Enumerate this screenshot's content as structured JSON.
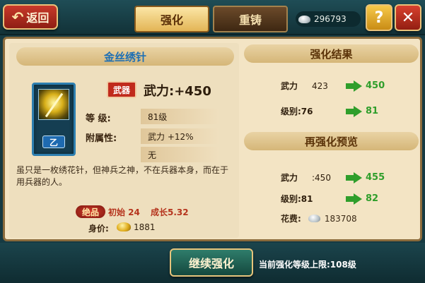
{
  "header": {
    "back_label": "返回",
    "tabs": [
      {
        "label": "强化",
        "active": true
      },
      {
        "label": "重铸",
        "active": false
      }
    ],
    "silver": "296793",
    "help_label": "?",
    "close_label": "✕"
  },
  "item": {
    "name": "金丝绣针",
    "grade": "乙",
    "type_stamp": "武器",
    "main_stat": "武力:+450",
    "level_label": "等  级:",
    "level_value": "81级",
    "attr_label": "附属性:",
    "attr_1": "武力 +12%",
    "attr_2": "无",
    "description": "虽只是一枚绣花针，但神兵之神，不在兵器本身，而在于用兵器的人。",
    "quality": "绝品",
    "initial": "初始 24",
    "growth": "成长5.32",
    "price_label": "身价:",
    "price": "1881"
  },
  "result": {
    "title": "强化结果",
    "rows": [
      {
        "label": "武力",
        "old": "423",
        "new": "450"
      },
      {
        "label": "级别:76",
        "old": "",
        "new": "81"
      }
    ]
  },
  "preview": {
    "title": "再强化预览",
    "rows": [
      {
        "label": "武力",
        "old": ":450",
        "new": "455"
      },
      {
        "label": "级别:81",
        "old": "",
        "new": "82"
      }
    ],
    "cost_label": "花费:",
    "cost": "183708"
  },
  "footer": {
    "continue_label": "继续强化",
    "limit_text": "当前强化等级上限:108级"
  },
  "colors": {
    "accent_green": "#2f9e2b",
    "item_name_blue": "#1d6fb4",
    "panel_bg": "#f3e4c4",
    "frame_dark": "#163a42"
  },
  "icons": [
    "back-arrow-icon",
    "silver-icon",
    "help-icon",
    "close-icon",
    "needle-item-icon",
    "up-arrow-icon",
    "gold-icon"
  ]
}
